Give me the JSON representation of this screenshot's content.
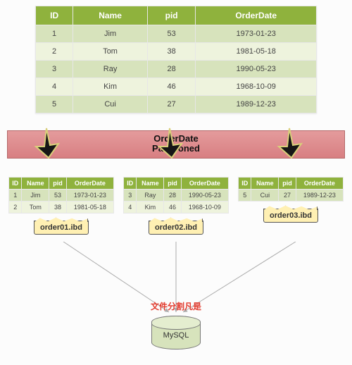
{
  "mainTable": {
    "headers": [
      "ID",
      "Name",
      "pid",
      "OrderDate"
    ],
    "rows": [
      [
        "1",
        "Jim",
        "53",
        "1973-01-23"
      ],
      [
        "2",
        "Tom",
        "38",
        "1981-05-18"
      ],
      [
        "3",
        "Ray",
        "28",
        "1990-05-23"
      ],
      [
        "4",
        "Kim",
        "46",
        "1968-10-09"
      ],
      [
        "5",
        "Cui",
        "27",
        "1989-12-23"
      ]
    ]
  },
  "bar": {
    "line1": "OrderDate",
    "line2": "Partitioned"
  },
  "partitions": [
    {
      "headers": [
        "ID",
        "Name",
        "pid",
        "OrderDate"
      ],
      "rows": [
        [
          "1",
          "Jim",
          "53",
          "1973-01-23"
        ],
        [
          "2",
          "Tom",
          "38",
          "1981-05-18"
        ]
      ],
      "file": "order01.ibd"
    },
    {
      "headers": [
        "ID",
        "Name",
        "pid",
        "OrderDate"
      ],
      "rows": [
        [
          "3",
          "Ray",
          "28",
          "1990-05-23"
        ],
        [
          "4",
          "Kim",
          "46",
          "1968-10-09"
        ]
      ],
      "file": "order02.ibd"
    },
    {
      "headers": [
        "ID",
        "Name",
        "pid",
        "OrderDate"
      ],
      "rows": [
        [
          "5",
          "Cui",
          "27",
          "1989-12-23"
        ]
      ],
      "file": "order03.ibd"
    }
  ],
  "bottom": {
    "label": "文件分割凡是",
    "db": "MySQL"
  }
}
